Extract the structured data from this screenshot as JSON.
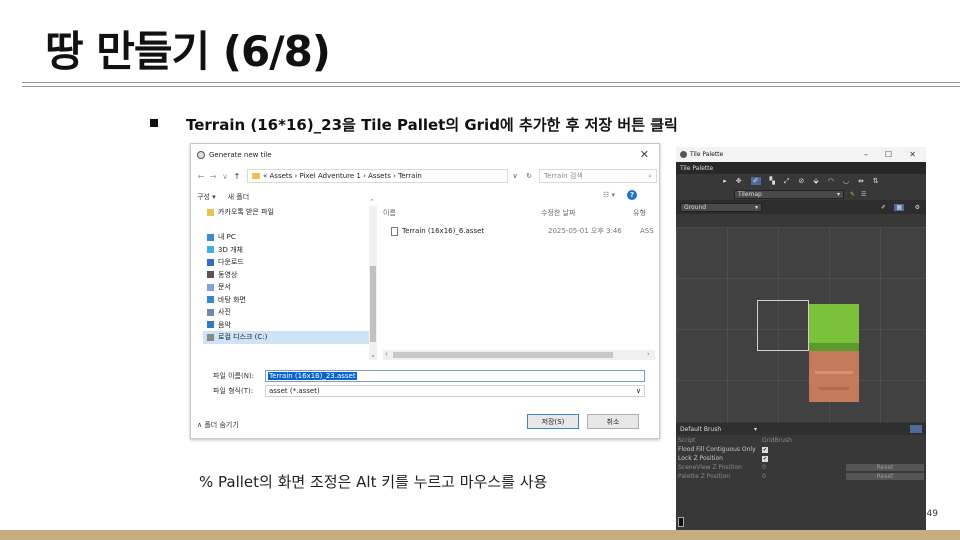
{
  "slide": {
    "title": "땅 만들기 (6/8)",
    "instruction": "Terrain (16*16)_23을 Tile Pallet의 Grid에 추가한 후 저장 버튼 클릭",
    "note": "% Pallet의 화면 조정은 Alt 키를 누르고 마우스를 사용",
    "page_number": "49"
  },
  "dialog": {
    "title": "Generate new tile",
    "close": "✕",
    "nav": {
      "back": "←",
      "forward": "→",
      "dropdown": "∨",
      "up": "↑"
    },
    "address": "« Assets › Pixel Adventure 1 › Assets › Terrain",
    "address_dropdown": "∨",
    "refresh": "↻",
    "search_placeholder": "Terrain 검색",
    "toolbar": {
      "organize": "구성 ▾",
      "new_folder": "새 폴더",
      "help": "?",
      "view": "☷ ▾"
    },
    "sidebar": [
      {
        "label": "카카오톡 받은 파일",
        "color": "#e8c24a",
        "selected": false
      },
      {
        "label": "",
        "color": "",
        "selected": false
      },
      {
        "label": "내 PC",
        "color": "#3d8ad8",
        "selected": false
      },
      {
        "label": "3D 개체",
        "color": "#3bb3e0",
        "selected": false
      },
      {
        "label": "다운로드",
        "color": "#2a6ec6",
        "selected": false
      },
      {
        "label": "동영상",
        "color": "#555555",
        "selected": false
      },
      {
        "label": "문서",
        "color": "#7aa7d8",
        "selected": false
      },
      {
        "label": "바탕 화면",
        "color": "#2f8ad8",
        "selected": false
      },
      {
        "label": "사진",
        "color": "#6b8bb0",
        "selected": false
      },
      {
        "label": "음악",
        "color": "#3377cc",
        "selected": false
      },
      {
        "label": "로컬 디스크 (C:)",
        "color": "#888888",
        "selected": true
      }
    ],
    "columns": {
      "name": "이름",
      "date": "수정한 날짜",
      "type": "유형"
    },
    "files": [
      {
        "name": "Terrain (16x16)_6.asset",
        "date": "2025-05-01 오후 3:46",
        "type": "ASS"
      }
    ],
    "filename_label": "파일 이름(N):",
    "filename_value": "Terrain (16x16)_23.asset",
    "filetype_label": "파일 형식(T):",
    "filetype_value": "asset (*.asset)",
    "hide_folders": "∧ 폴더 숨기기",
    "save_button": "저장(S)",
    "cancel_button": "취소"
  },
  "palette": {
    "window_title": "Tile Palette",
    "window_controls": {
      "minimize": "–",
      "maximize": "☐",
      "close": "✕"
    },
    "tab": "Tile Palette",
    "tools": [
      "▸",
      "✥",
      "✐",
      "▚",
      "⤢",
      "⊘",
      "⬙",
      "◠",
      "◡",
      "⇹",
      "⇅"
    ],
    "active_tool_index": 2,
    "active_tilemap": "Tilemap",
    "palette_name": "Ground",
    "brush": "Default Brush",
    "properties": [
      {
        "label": "Script",
        "value": "GridBrush",
        "kind": "field",
        "dim": true
      },
      {
        "label": "Flood Fill Contiguous Only",
        "value": "✔",
        "kind": "check",
        "dim": false
      },
      {
        "label": "Lock Z Position",
        "value": "✔",
        "kind": "check",
        "dim": false
      },
      {
        "label": "SceneView Z Position",
        "value": "0",
        "kind": "reset",
        "dim": true
      },
      {
        "label": "Palette Z Position",
        "value": "0",
        "kind": "reset",
        "dim": true
      }
    ],
    "reset_label": "Reset"
  }
}
